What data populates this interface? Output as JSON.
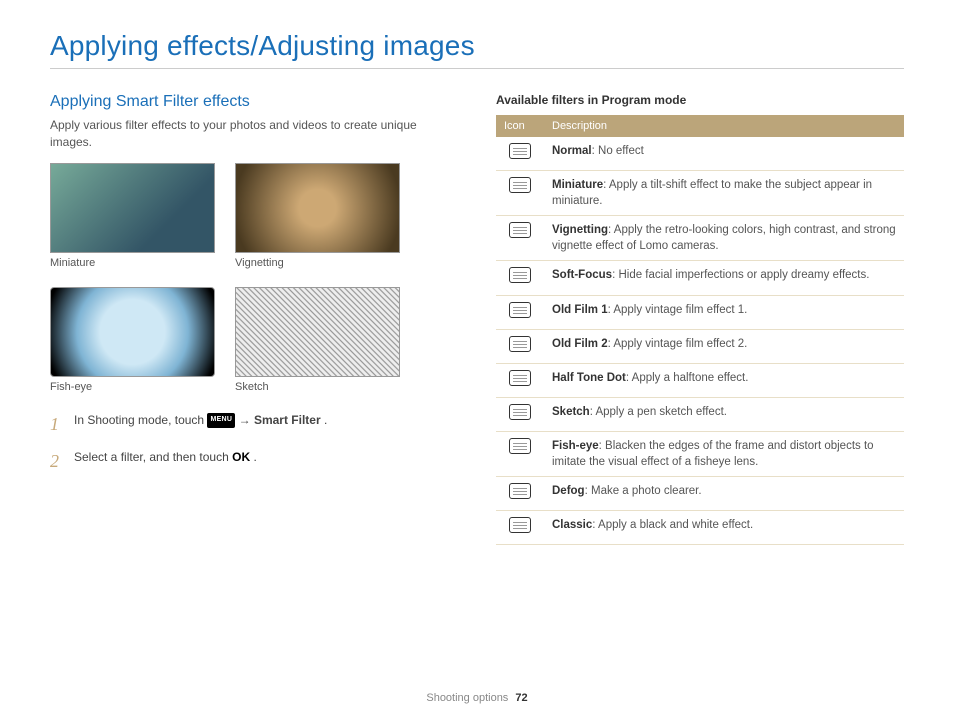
{
  "page_title": "Applying effects/Adjusting images",
  "section_title": "Applying Smart Filter effects",
  "intro": "Apply various filter effects to your photos and videos to create unique images.",
  "samples": [
    {
      "caption": "Miniature"
    },
    {
      "caption": "Vignetting"
    },
    {
      "caption": "Fish-eye"
    },
    {
      "caption": "Sketch"
    }
  ],
  "steps": {
    "s1_num": "1",
    "s1_a": "In Shooting mode, touch ",
    "s1_menu": "MENU",
    "s1_b": " → ",
    "s1_c": "Smart Filter",
    "s1_d": ".",
    "s2_num": "2",
    "s2_a": "Select a filter, and then touch ",
    "s2_ok": "OK",
    "s2_b": "."
  },
  "table_title": "Available filters in Program mode",
  "table_headers": {
    "icon": "Icon",
    "desc": "Description"
  },
  "filters": [
    {
      "name": "Normal",
      "desc": ": No effect"
    },
    {
      "name": "Miniature",
      "desc": ": Apply a tilt-shift effect to make the subject appear in miniature."
    },
    {
      "name": "Vignetting",
      "desc": ": Apply the retro-looking colors, high contrast, and strong vignette effect of Lomo cameras."
    },
    {
      "name": "Soft-Focus",
      "desc": ": Hide facial imperfections or apply dreamy effects."
    },
    {
      "name": "Old Film 1",
      "desc": ": Apply vintage film effect 1."
    },
    {
      "name": "Old Film 2",
      "desc": ": Apply vintage film effect 2."
    },
    {
      "name": "Half Tone Dot",
      "desc": ": Apply a halftone effect."
    },
    {
      "name": "Sketch",
      "desc": ": Apply a pen sketch effect."
    },
    {
      "name": "Fish-eye",
      "desc": ": Blacken the edges of the frame and distort objects to imitate the visual effect of a fisheye lens."
    },
    {
      "name": "Defog",
      "desc": ": Make a photo clearer."
    },
    {
      "name": "Classic",
      "desc": ": Apply a black and white effect."
    }
  ],
  "footer": {
    "section": "Shooting options",
    "page": "72"
  }
}
